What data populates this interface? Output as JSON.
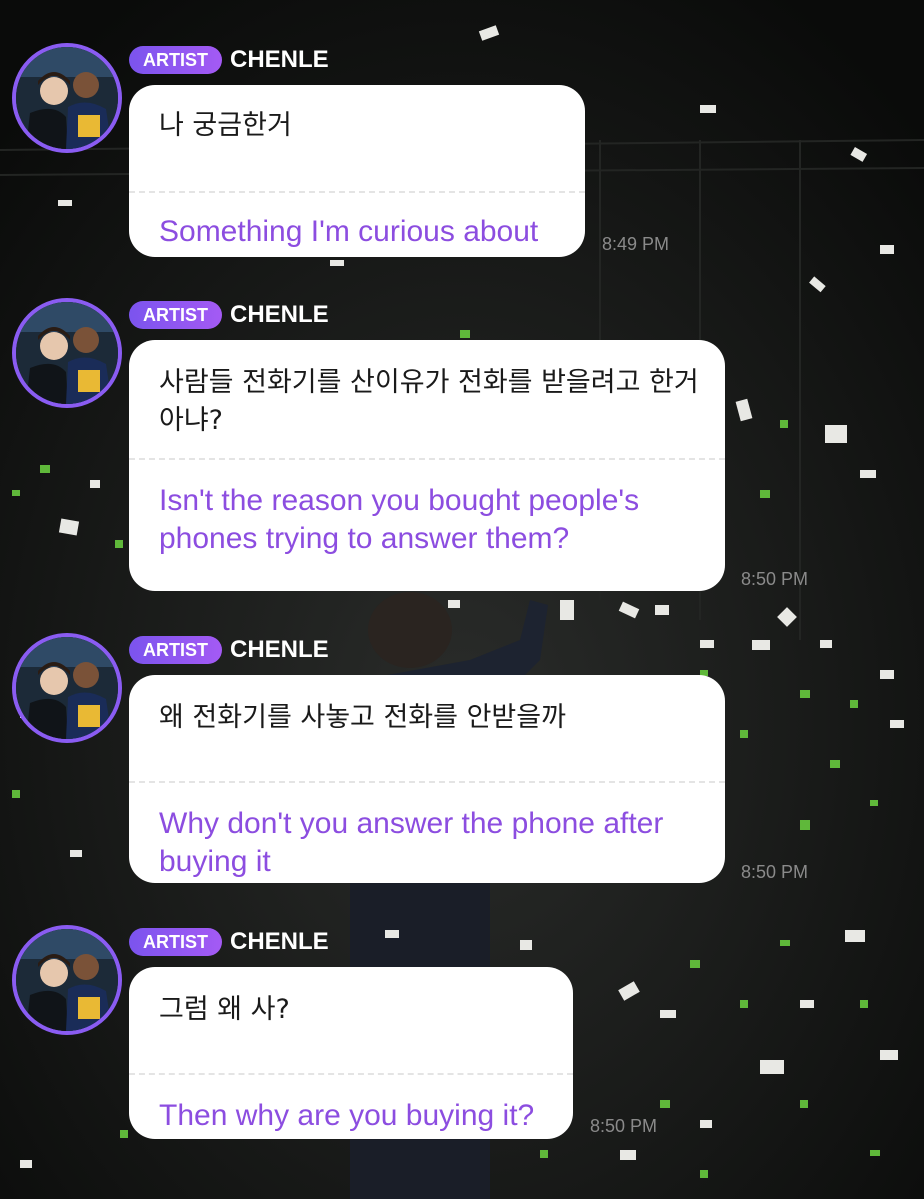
{
  "messages": [
    {
      "badge": "ARTIST",
      "name": "CHENLE",
      "korean": "나 궁금한거",
      "english": "Something I'm curious about",
      "time": "8:49 PM"
    },
    {
      "badge": "ARTIST",
      "name": "CHENLE",
      "korean": "사람들 전화기를 산이유가 전화를 받을려고 한거 아냐?",
      "english": "Isn't the reason you bought people's phones trying to answer them?",
      "time": "8:50 PM"
    },
    {
      "badge": "ARTIST",
      "name": "CHENLE",
      "korean": "왜 전화기를 사놓고 전화를 안받을까",
      "english": "Why don't you answer the phone after buying it",
      "time": "8:50 PM"
    },
    {
      "badge": "ARTIST",
      "name": "CHENLE",
      "korean": "그럼 왜 사?",
      "english": "Then why are you buying it?",
      "time": "8:50 PM"
    }
  ],
  "colors": {
    "badge_start": "#7b54ee",
    "badge_end": "#a45af4",
    "translation_text": "#8c4de0",
    "avatar_ring": "#8a5cf2",
    "background": "#0d0f0e"
  },
  "icons": {
    "avatar": "artist-profile-photo",
    "background": "concert-confetti-photo"
  }
}
